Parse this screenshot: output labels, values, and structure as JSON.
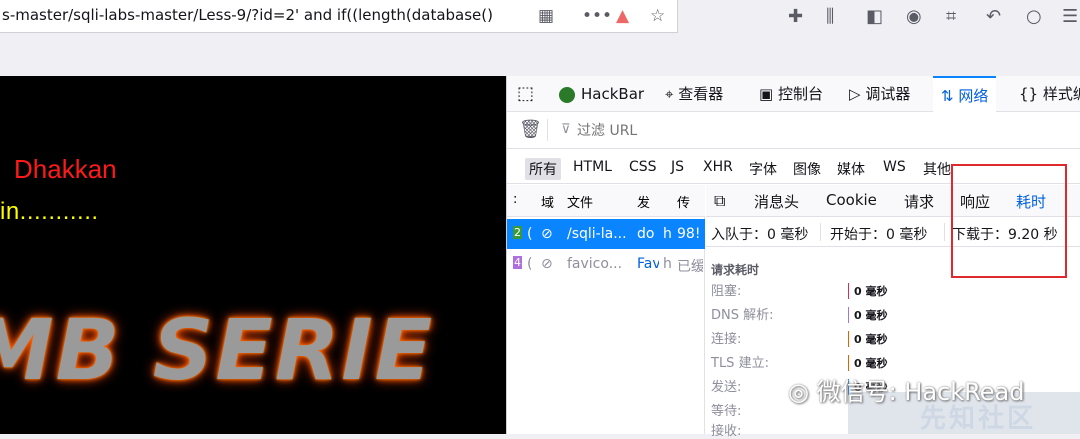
{
  "browser": {
    "url": "s-master/sqli-labs-master/Less-9/?id=2' and if((length(database()"
  },
  "page": {
    "name_text": "Dhakkan",
    "yellow_text": "in...........",
    "banner_text": "MB SERIE"
  },
  "devtools": {
    "tabs": [
      "HackBar",
      "查看器",
      "控制台",
      "调试器",
      "网络",
      "样式编"
    ],
    "filter_placeholder": "过滤 URL",
    "filter_types": [
      "所有",
      "HTML",
      "CSS",
      "JS",
      "XHR",
      "字体",
      "图像",
      "媒体",
      "WS",
      "其他"
    ],
    "list_headers": [
      "域",
      "文件",
      "发",
      "传"
    ],
    "requests": [
      {
        "status": "2",
        "domain": "(",
        "file": "/sqli-la...",
        "initiator": "do",
        "type": "h",
        "size": "98!"
      },
      {
        "status": "4",
        "domain": "(",
        "file": "favico...",
        "initiator": "Fav",
        "type": "h",
        "size": "已缓"
      }
    ],
    "panel_tabs": [
      "消息头",
      "Cookie",
      "请求",
      "响应",
      "耗时"
    ],
    "timing_summary": {
      "queued": "入队于：0 毫秒",
      "started": "开始于：0 毫秒",
      "downloaded": "下载于：9.20 秒"
    },
    "section_title": "请求耗时",
    "timing_rows": [
      {
        "label": "阻塞:",
        "value": "0 毫秒"
      },
      {
        "label": "DNS 解析:",
        "value": "0 毫秒"
      },
      {
        "label": "连接:",
        "value": "0 毫秒"
      },
      {
        "label": "TLS 建立:",
        "value": "0 毫秒"
      },
      {
        "label": "发送:",
        "value": "0 毫秒"
      },
      {
        "label": "等待:",
        "value": ""
      },
      {
        "label": "接收:",
        "value": ""
      }
    ]
  },
  "watermark": {
    "text": "微信号: HackRead",
    "logo_text": "先知社区"
  },
  "colors": {
    "accent": "#0a84ff",
    "highlight_box": "#e0292d",
    "name_red": "#ff1a1a",
    "text_yellow": "#ffff00"
  }
}
